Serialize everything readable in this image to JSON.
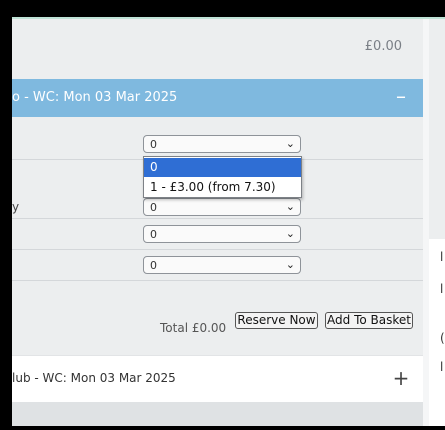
{
  "summary": {
    "price": "£0.00"
  },
  "week_panel": {
    "header": "o - WC: Mon 03 Mar 2025",
    "collapse_symbol": "–",
    "rows": [
      {
        "label": "",
        "selected": "0"
      },
      {
        "label": "y",
        "selected": "0"
      },
      {
        "label": "",
        "selected": "0"
      },
      {
        "label": "",
        "selected": "0"
      }
    ],
    "dropdown_options": [
      "0",
      "1 - £3.00 (from 7.30)"
    ],
    "total": "Total £0.00",
    "reserve_label": "Reserve Now",
    "basket_label": "Add To Basket"
  },
  "club_panel": {
    "header": "lub - WC: Mon 03 Mar 2025",
    "expand_symbol": "+"
  },
  "right_column": {
    "chars": [
      "l",
      "l",
      "(",
      "l"
    ]
  },
  "icons": {
    "select_arrow": "chevron-down-icon"
  }
}
